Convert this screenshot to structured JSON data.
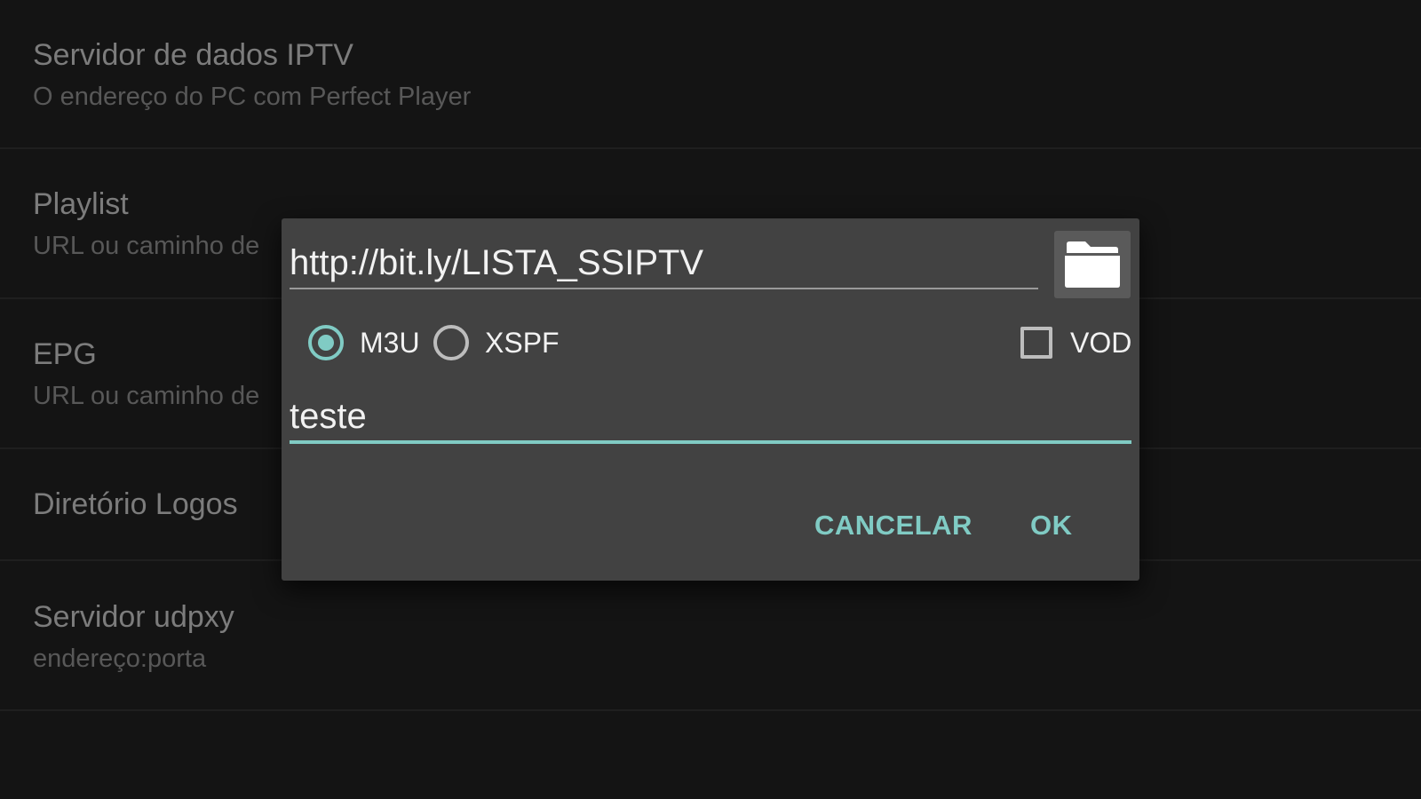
{
  "settings": {
    "items": [
      {
        "title": "Servidor de dados IPTV",
        "subtitle": "O endereço do PC com Perfect Player"
      },
      {
        "title": "Playlist",
        "subtitle": "URL ou caminho de"
      },
      {
        "title": "EPG",
        "subtitle": "URL ou caminho de"
      },
      {
        "title": "Diretório Logos",
        "subtitle": ""
      },
      {
        "title": "Servidor udpxy",
        "subtitle": "endereço:porta"
      }
    ]
  },
  "dialog": {
    "url_value": "http://bit.ly/LISTA_SSIPTV",
    "folder_icon": "folder-icon",
    "format_options": [
      {
        "label": "M3U",
        "checked": true
      },
      {
        "label": "XSPF",
        "checked": false
      }
    ],
    "vod": {
      "label": "VOD",
      "checked": false
    },
    "name_value": "teste",
    "cancel_label": "CANCELAR",
    "ok_label": "OK"
  },
  "colors": {
    "accent": "#80cbc4",
    "background": "#141414",
    "dialog_background": "#424242"
  }
}
